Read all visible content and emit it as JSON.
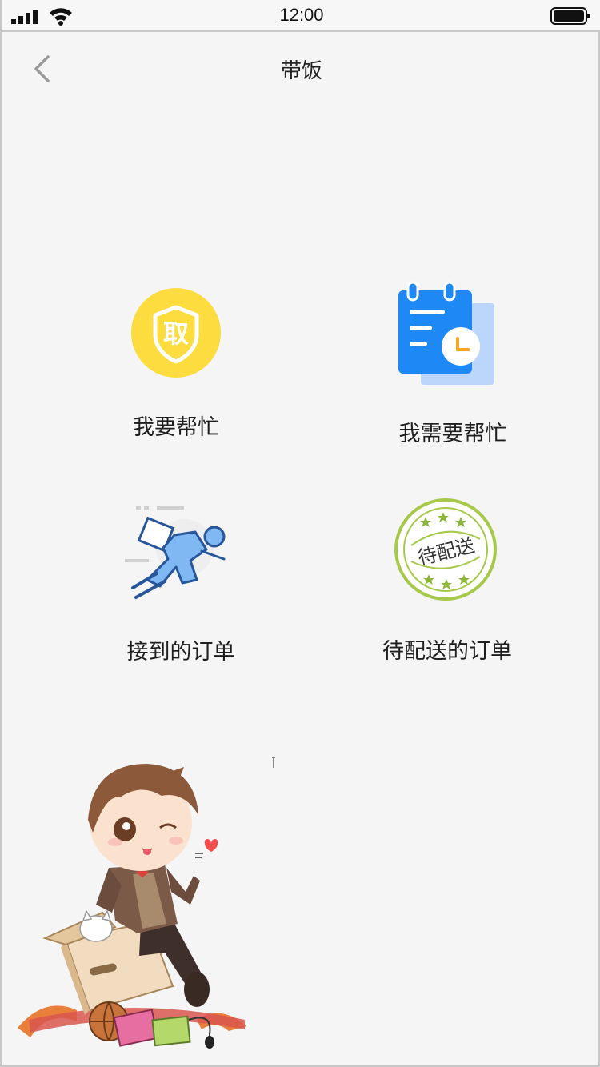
{
  "status_bar": {
    "time": "12:00",
    "signal_icon": "cellular-signal-icon",
    "wifi_icon": "wifi-icon",
    "battery_icon": "battery-icon"
  },
  "nav": {
    "title": "带饭",
    "back_icon": "chevron-left-icon"
  },
  "menu": [
    {
      "label": "我要帮忙",
      "icon": "shield-qu-icon",
      "icon_text": "取",
      "color": "#fcdc3f"
    },
    {
      "label": "我需要帮忙",
      "icon": "calendar-clock-icon",
      "color": "#1e88f5"
    },
    {
      "label": "接到的订单",
      "icon": "running-delivery-icon",
      "color": "#5aa3e8"
    },
    {
      "label": "待配送的订单",
      "icon": "stamp-icon",
      "icon_text": "待配送",
      "color": "#a6c94a"
    }
  ],
  "mascot": {
    "icon": "chibi-boy-illustration"
  }
}
